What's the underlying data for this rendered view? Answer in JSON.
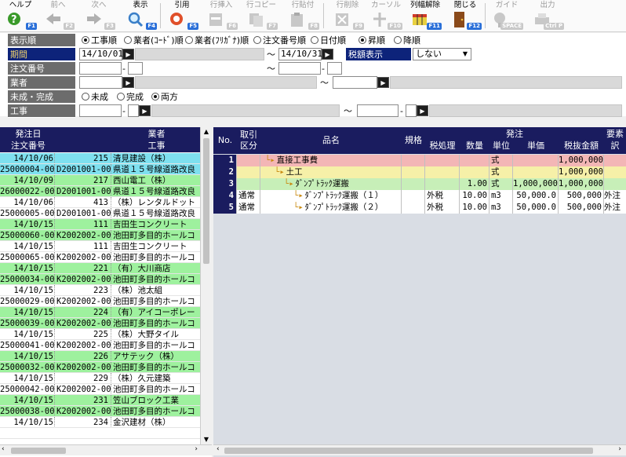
{
  "toolbar": {
    "help": {
      "label": "ヘルプ",
      "key": "F1"
    },
    "prev": {
      "label": "前へ",
      "key": "F2"
    },
    "next": {
      "label": "次へ",
      "key": "F3"
    },
    "show": {
      "label": "表示",
      "key": "F4"
    },
    "cite": {
      "label": "引用",
      "key": "F5"
    },
    "row_insert": {
      "label": "行挿入",
      "key": "F6"
    },
    "row_copy": {
      "label": "行コピー",
      "key": "F7"
    },
    "row_paste": {
      "label": "行貼付",
      "key": "F8"
    },
    "row_delete": {
      "label": "行削除",
      "key": "F9"
    },
    "cursor": {
      "label": "カーソル",
      "key": "F10"
    },
    "col_width_reset": {
      "label": "列幅解除",
      "key": "F11"
    },
    "close": {
      "label": "閉じる",
      "key": "F12"
    },
    "guide": {
      "label": "ガイド",
      "key": "SPACE"
    },
    "output": {
      "label": "出力",
      "key": "Ctrl P"
    }
  },
  "filters": {
    "sort": {
      "label": "表示順",
      "options": [
        "工事順",
        "業者(ｺｰﾄﾞ)順",
        "業者(ﾌﾘｶﾞﾅ)順",
        "注文番号順",
        "日付順"
      ],
      "selected": "工事順",
      "direction": [
        "昇順",
        "降順"
      ],
      "direction_selected": "昇順"
    },
    "period": {
      "label": "期間",
      "from": "14/10/01",
      "tilde": "～",
      "to": "14/10/31"
    },
    "tax": {
      "label": "税額表示",
      "value": "しない"
    },
    "order_no": {
      "label": "注文番号",
      "dash": "-",
      "tilde": "～"
    },
    "vendor": {
      "label": "業者",
      "tilde": "～"
    },
    "completion": {
      "label": "未成・完成",
      "options": [
        "未成",
        "完成",
        "両方"
      ],
      "selected": "両方"
    },
    "work": {
      "label": "工事",
      "dash": "-",
      "tilde": "～"
    }
  },
  "left_table": {
    "headers": {
      "date": "発注日",
      "order_no": "注文番号",
      "vendor": "業者",
      "work": "工事"
    },
    "rows": [
      {
        "date": "14/10/06",
        "code": "215",
        "vendor": "清見建設（株）",
        "order_no": "25000004-00",
        "work_code": "D2001001-00",
        "work": "県道１５号線道路改良",
        "color": "#7ee0ef"
      },
      {
        "date": "14/10/09",
        "code": "217",
        "vendor": "西山電工（株）",
        "order_no": "26000022-00",
        "work_code": "D2001001-00",
        "work": "県道１５号線道路改良",
        "color": "#9ef19e"
      },
      {
        "date": "14/10/06",
        "code": "413",
        "vendor": "（株）レンタルドット",
        "order_no": "25000005-00",
        "work_code": "D2001001-00",
        "work": "県道１５号線道路改良",
        "color": "#ffffff"
      },
      {
        "date": "14/10/15",
        "code": "111",
        "vendor": "吉田生コンクリート",
        "order_no": "25000060-00",
        "work_code": "K2002002-00",
        "work": "池田町多目的ホールコ",
        "color": "#9ef19e"
      },
      {
        "date": "14/10/15",
        "code": "111",
        "vendor": "吉田生コンクリート",
        "order_no": "25000065-00",
        "work_code": "K2002002-00",
        "work": "池田町多目的ホールコ",
        "color": "#ffffff"
      },
      {
        "date": "14/10/15",
        "code": "221",
        "vendor": "（有）大川商店",
        "order_no": "25000034-00",
        "work_code": "K2002002-00",
        "work": "池田町多目的ホールコ",
        "color": "#9ef19e"
      },
      {
        "date": "14/10/15",
        "code": "223",
        "vendor": "（株）池太組",
        "order_no": "25000029-00",
        "work_code": "K2002002-00",
        "work": "池田町多目的ホールコ",
        "color": "#ffffff"
      },
      {
        "date": "14/10/15",
        "code": "224",
        "vendor": "（有）アイコーポレー",
        "order_no": "25000039-00",
        "work_code": "K2002002-00",
        "work": "池田町多目的ホールコ",
        "color": "#9ef19e"
      },
      {
        "date": "14/10/15",
        "code": "225",
        "vendor": "（株）大野タイル",
        "order_no": "25000041-00",
        "work_code": "K2002002-00",
        "work": "池田町多目的ホールコ",
        "color": "#ffffff"
      },
      {
        "date": "14/10/15",
        "code": "226",
        "vendor": "アサテック（株）",
        "order_no": "25000032-00",
        "work_code": "K2002002-00",
        "work": "池田町多目的ホールコ",
        "color": "#9ef19e"
      },
      {
        "date": "14/10/15",
        "code": "229",
        "vendor": "（株）久元建築",
        "order_no": "25000042-00",
        "work_code": "K2002002-00",
        "work": "池田町多目的ホールコ",
        "color": "#ffffff"
      },
      {
        "date": "14/10/15",
        "code": "231",
        "vendor": "笠山ブロック工業",
        "order_no": "25000038-00",
        "work_code": "K2002002-00",
        "work": "池田町多目的ホールコ",
        "color": "#9ef19e"
      },
      {
        "date": "14/10/15",
        "code": "234",
        "vendor": "金沢建材（株）",
        "order_no": "",
        "work_code": "",
        "work": "",
        "color": "#ffffff"
      }
    ]
  },
  "right_table": {
    "headers": {
      "no": "No.",
      "trade": "取引",
      "trade2": "区分",
      "item": "品名",
      "spec": "規格",
      "order": "発注",
      "tax": "税処理",
      "qty": "数量",
      "unit": "単位",
      "price": "単価",
      "amount": "税抜金額",
      "req": "要素",
      "req2": "訳"
    },
    "rows": [
      {
        "no": "1",
        "trade": "",
        "item": "直接工事費",
        "spec": "",
        "tax": "",
        "qty": "",
        "unit": "式",
        "price": "",
        "amount": "1,000,000",
        "req": "",
        "color": "#f3b6b6",
        "indent": 1
      },
      {
        "no": "2",
        "trade": "",
        "item": "土工",
        "spec": "",
        "tax": "",
        "qty": "",
        "unit": "式",
        "price": "",
        "amount": "1,000,000",
        "req": "",
        "color": "#f6f0a8",
        "indent": 2
      },
      {
        "no": "3",
        "trade": "",
        "item": "ﾀﾞﾝﾌﾟﾄﾗｯｸ運搬",
        "spec": "",
        "tax": "",
        "qty": "1.00",
        "unit": "式",
        "price": "1,000,000",
        "amount": "1,000,000",
        "req": "",
        "color": "#c7efb8",
        "indent": 3
      },
      {
        "no": "4",
        "trade": "通常",
        "item": "ﾀﾞﾝﾌﾟﾄﾗｯｸ運搬（１）",
        "spec": "",
        "tax": "外税",
        "qty": "10.00",
        "unit": "m3",
        "price": "50,000.0",
        "amount": "500,000",
        "req": "外注",
        "color": "#ffffff",
        "indent": 4
      },
      {
        "no": "5",
        "trade": "通常",
        "item": "ﾀﾞﾝﾌﾟﾄﾗｯｸ運搬（２）",
        "spec": "",
        "tax": "外税",
        "qty": "10.00",
        "unit": "m3",
        "price": "50,000.0",
        "amount": "500,000",
        "req": "外注",
        "color": "#ffffff",
        "indent": 4
      }
    ]
  },
  "colors": {
    "header_bg": "#1a1c5f",
    "label_gray": "#6c6c6c",
    "accent": "#2a6fd8"
  }
}
